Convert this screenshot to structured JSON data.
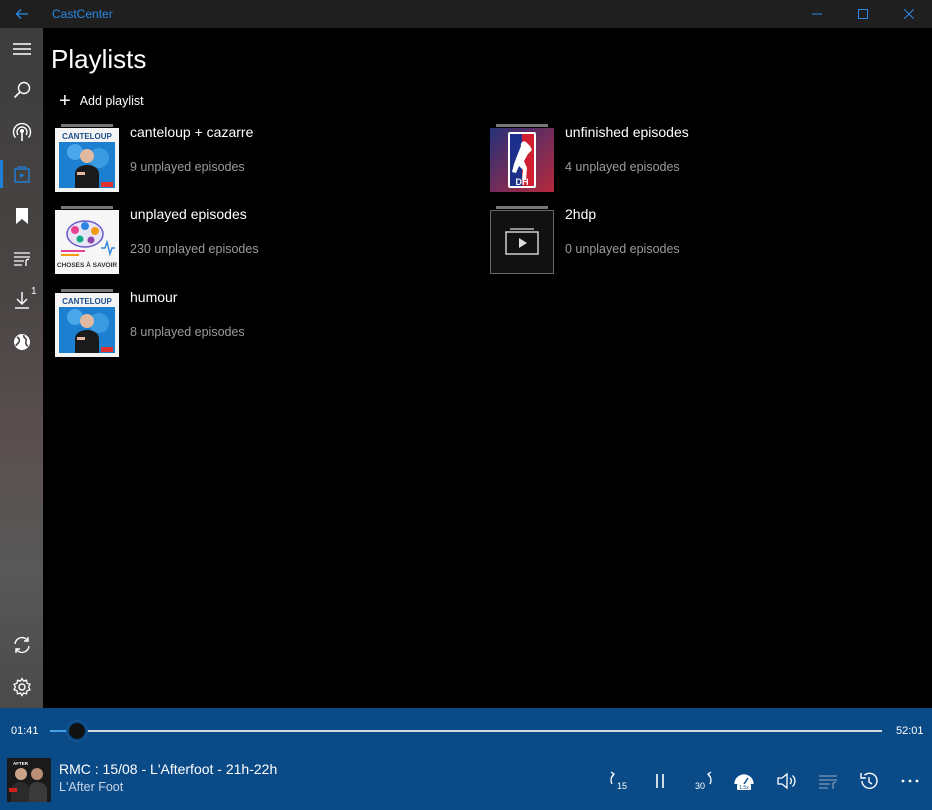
{
  "window": {
    "title": "CastCenter",
    "back_icon": "back-arrow-icon",
    "controls": [
      "minimize-icon",
      "maximize-icon",
      "close-icon"
    ]
  },
  "sidebar": {
    "items": [
      {
        "icon": "hamburger-menu-icon",
        "active": false
      },
      {
        "icon": "search-icon",
        "active": false
      },
      {
        "icon": "podcast-icon",
        "active": false
      },
      {
        "icon": "playlists-icon",
        "active": true
      },
      {
        "icon": "bookmark-icon",
        "active": false
      },
      {
        "icon": "queue-icon",
        "active": false
      },
      {
        "icon": "download-icon",
        "active": false,
        "badge": "1"
      },
      {
        "icon": "globe-icon",
        "active": false
      },
      {
        "icon": "sync-icon",
        "active": false
      },
      {
        "icon": "settings-gear-icon",
        "active": false
      }
    ]
  },
  "main": {
    "page_title": "Playlists",
    "add_playlist_label": "Add playlist",
    "playlists": [
      {
        "name": "canteloup + cazarre",
        "count": "9 unplayed episodes",
        "art": "canteloup"
      },
      {
        "name": "unfinished episodes",
        "count": "4 unplayed episodes",
        "art": "dh"
      },
      {
        "name": "unplayed episodes",
        "count": "230 unplayed episodes",
        "art": "brain"
      },
      {
        "name": "2hdp",
        "count": "0 unplayed episodes",
        "art": "video"
      },
      {
        "name": "humour",
        "count": "8 unplayed episodes",
        "art": "canteloup"
      }
    ]
  },
  "player": {
    "elapsed": "01:41",
    "duration": "52:01",
    "progress": 0.032,
    "episode_title": "RMC : 15/08 - L'Afterfoot - 21h-22h",
    "show_name": "L'After Foot",
    "controls": {
      "rewind_label": "15",
      "forward_label": "30",
      "speed_label": "1.5x"
    }
  },
  "colors": {
    "accent": "#2a8ae6",
    "player_bg": "#0a4a86",
    "sidebar_bg": "#454545",
    "secondary_text": "#9b9b9b"
  }
}
